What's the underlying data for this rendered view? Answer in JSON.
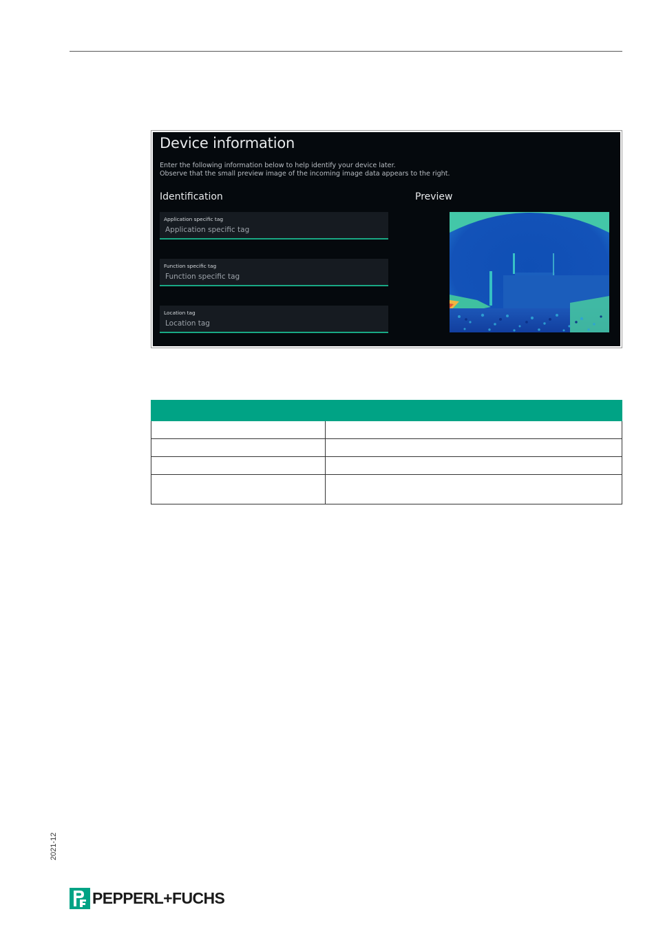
{
  "screenshot": {
    "title": "Device information",
    "description_line1": "Enter the following information below to help identify your device later.",
    "description_line2": "Observe that the small preview image of the incoming image data appears to the right.",
    "identification_heading": "Identification",
    "preview_heading": "Preview",
    "fields": [
      {
        "label": "Application specific tag",
        "placeholder": "Application specific tag"
      },
      {
        "label": "Function specific tag",
        "placeholder": "Function specific tag"
      },
      {
        "label": "Location tag",
        "placeholder": "Location tag"
      }
    ],
    "accent_color": "#19a985"
  },
  "table": {
    "header_color": "#00a385",
    "headers": [
      "",
      ""
    ],
    "rows": [
      [
        "",
        ""
      ],
      [
        "",
        ""
      ],
      [
        "",
        ""
      ],
      [
        "",
        ""
      ]
    ]
  },
  "footer": {
    "date_code": "2021-12",
    "brand": "PEPPERL+FUCHS",
    "brand_color": "#00a385"
  }
}
